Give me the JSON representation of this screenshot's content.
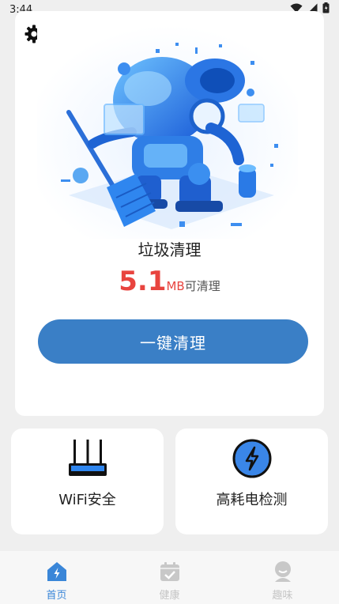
{
  "status_bar": {
    "time": "3:44",
    "icons": [
      "wifi-icon",
      "signal-icon",
      "battery-icon"
    ]
  },
  "hero": {
    "title": "垃圾清理",
    "junk_size": "5.1",
    "junk_unit": "MB",
    "junk_suffix": "可清理",
    "clean_button_label": "一键清理",
    "illustration": "robot-cleaning-illustration"
  },
  "features": [
    {
      "label": "WiFi安全",
      "icon": "router-icon"
    },
    {
      "label": "高耗电检测",
      "icon": "lightning-icon"
    }
  ],
  "bottom_nav": {
    "items": [
      {
        "label": "首页",
        "icon": "home-icon",
        "active": true
      },
      {
        "label": "健康",
        "icon": "calendar-check-icon",
        "active": false
      },
      {
        "label": "趣味",
        "icon": "face-icon",
        "active": false
      }
    ]
  },
  "colors": {
    "accent": "#3a7fc6",
    "active_nav": "#3a86d8",
    "junk_red": "#e8443f",
    "inactive_nav": "#c5c5c5",
    "background": "#efefef"
  }
}
